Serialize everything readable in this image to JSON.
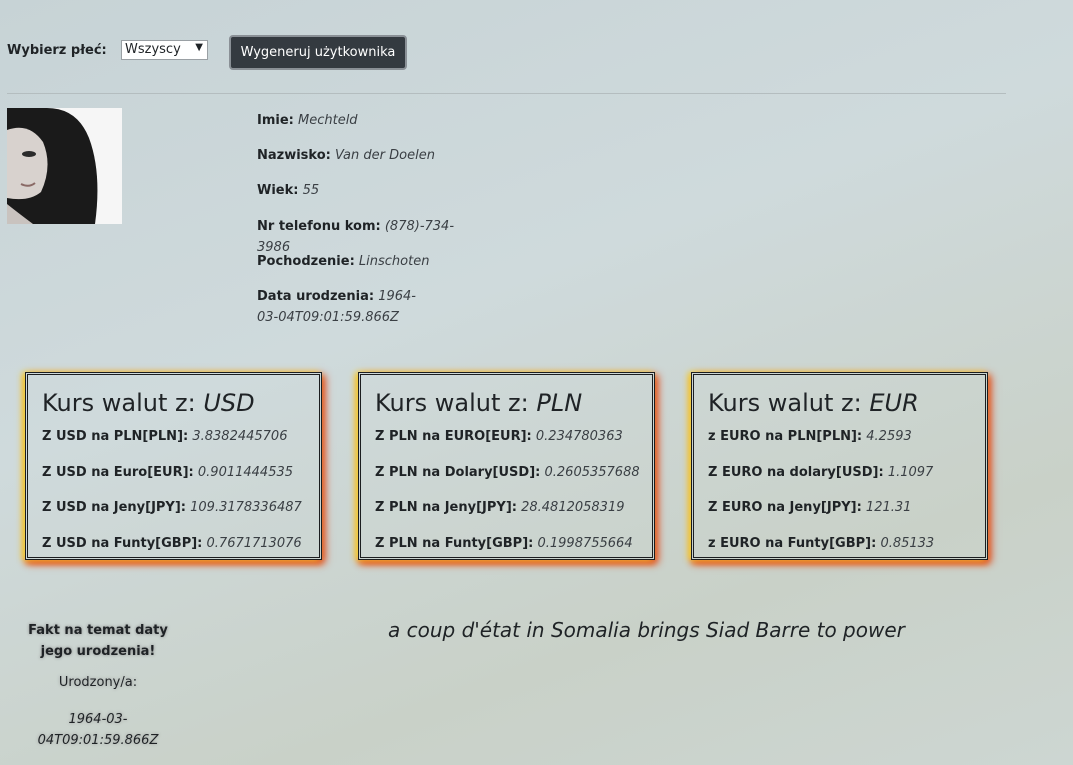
{
  "controls": {
    "gender_label": "Wybierz płeć:",
    "gender_selected": "Wszyscy",
    "generate_button": "Wygeneruj użytkownika"
  },
  "user": {
    "fields": [
      {
        "label": "Imie:",
        "value": "Mechteld"
      },
      {
        "label": "Nazwisko:",
        "value": "Van der Doelen"
      },
      {
        "label": "Wiek:",
        "value": "55"
      },
      {
        "label": "Nr telefonu kom:",
        "value": "(878)-734-3986"
      },
      {
        "label": "Pochodzenie:",
        "value": "Linschoten"
      },
      {
        "label": "Data urodzenia:",
        "value": "1964-03-04T09:01:59.866Z"
      }
    ]
  },
  "rates": [
    {
      "title_prefix": "Kurs walut z:",
      "currency": "USD",
      "items": [
        {
          "label": "Z USD na PLN[PLN]:",
          "value": "3.8382445706"
        },
        {
          "label": "Z USD na Euro[EUR]:",
          "value": "0.9011444535"
        },
        {
          "label": "Z USD na Jeny[JPY]:",
          "value": "109.3178336487"
        },
        {
          "label": "Z USD na Funty[GBP]:",
          "value": "0.7671713076"
        }
      ]
    },
    {
      "title_prefix": "Kurs walut z:",
      "currency": "PLN",
      "items": [
        {
          "label": "Z PLN na EURO[EUR]:",
          "value": "0.234780363"
        },
        {
          "label": "Z PLN na Dolary[USD]:",
          "value": "0.2605357688"
        },
        {
          "label": "Z PLN na Jeny[JPY]:",
          "value": "28.4812058319"
        },
        {
          "label": "Z PLN na Funty[GBP]:",
          "value": "0.1998755664"
        }
      ]
    },
    {
      "title_prefix": "Kurs walut z:",
      "currency": "EUR",
      "items": [
        {
          "label": "z EURO na PLN[PLN]:",
          "value": "4.2593"
        },
        {
          "label": "Z EURO na dolary[USD]:",
          "value": "1.1097"
        },
        {
          "label": "Z EURO na Jeny[JPY]:",
          "value": "121.31"
        },
        {
          "label": "z EURO na Funty[GBP]:",
          "value": "0.85133"
        }
      ]
    }
  ],
  "fact": {
    "title": "Fakt na temat daty jego urodzenia!",
    "born_label": "Urodzony/a:",
    "born_value": "1964-03-04T09:01:59.866Z",
    "text": "a coup d'état in Somalia brings Siad Barre to power"
  }
}
